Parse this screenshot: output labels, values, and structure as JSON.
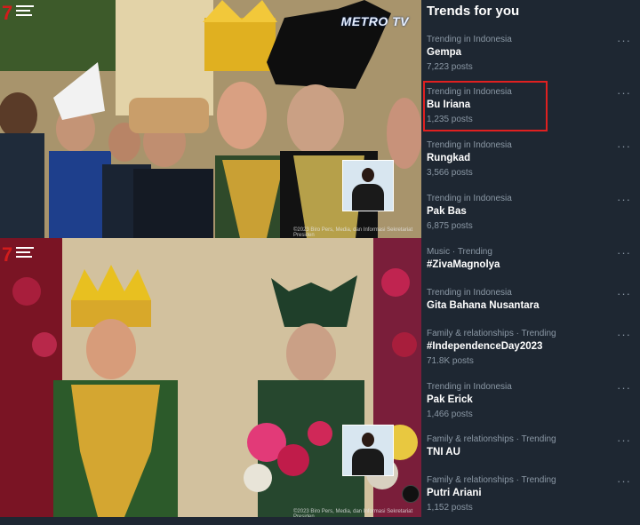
{
  "photos": {
    "top_channel_logo": "METRO TV",
    "top_caption": "©2023 Biro Pers, Media, dan Informasi Sekretariat Presiden",
    "bottom_caption": "©2023 Biro Pers, Media, dan Informasi Sekretariat Presiden"
  },
  "trends_panel": {
    "title": "Trends for you",
    "more_icon": "more-horizontal-icon",
    "highlight_color": "#e02020",
    "items": [
      {
        "context": "Trending in Indonesia",
        "name": "Gempa",
        "posts": "7,223 posts"
      },
      {
        "context": "Trending in Indonesia",
        "name": "Bu Iriana",
        "posts": "1,235 posts"
      },
      {
        "context": "Trending in Indonesia",
        "name": "Rungkad",
        "posts": "3,566 posts"
      },
      {
        "context": "Trending in Indonesia",
        "name": "Pak Bas",
        "posts": "6,875 posts"
      },
      {
        "context": "Music · Trending",
        "name": "#ZivaMagnolya",
        "posts": ""
      },
      {
        "context": "Trending in Indonesia",
        "name": "Gita Bahana Nusantara",
        "posts": ""
      },
      {
        "context": "Family & relationships · Trending",
        "name": "#IndependenceDay2023",
        "posts": "71.8K posts"
      },
      {
        "context": "Trending in Indonesia",
        "name": "Pak Erick",
        "posts": "1,466 posts"
      },
      {
        "context": "Family & relationships · Trending",
        "name": "TNI AU",
        "posts": ""
      },
      {
        "context": "Family & relationships · Trending",
        "name": "Putri Ariani",
        "posts": "1,152 posts"
      }
    ]
  }
}
